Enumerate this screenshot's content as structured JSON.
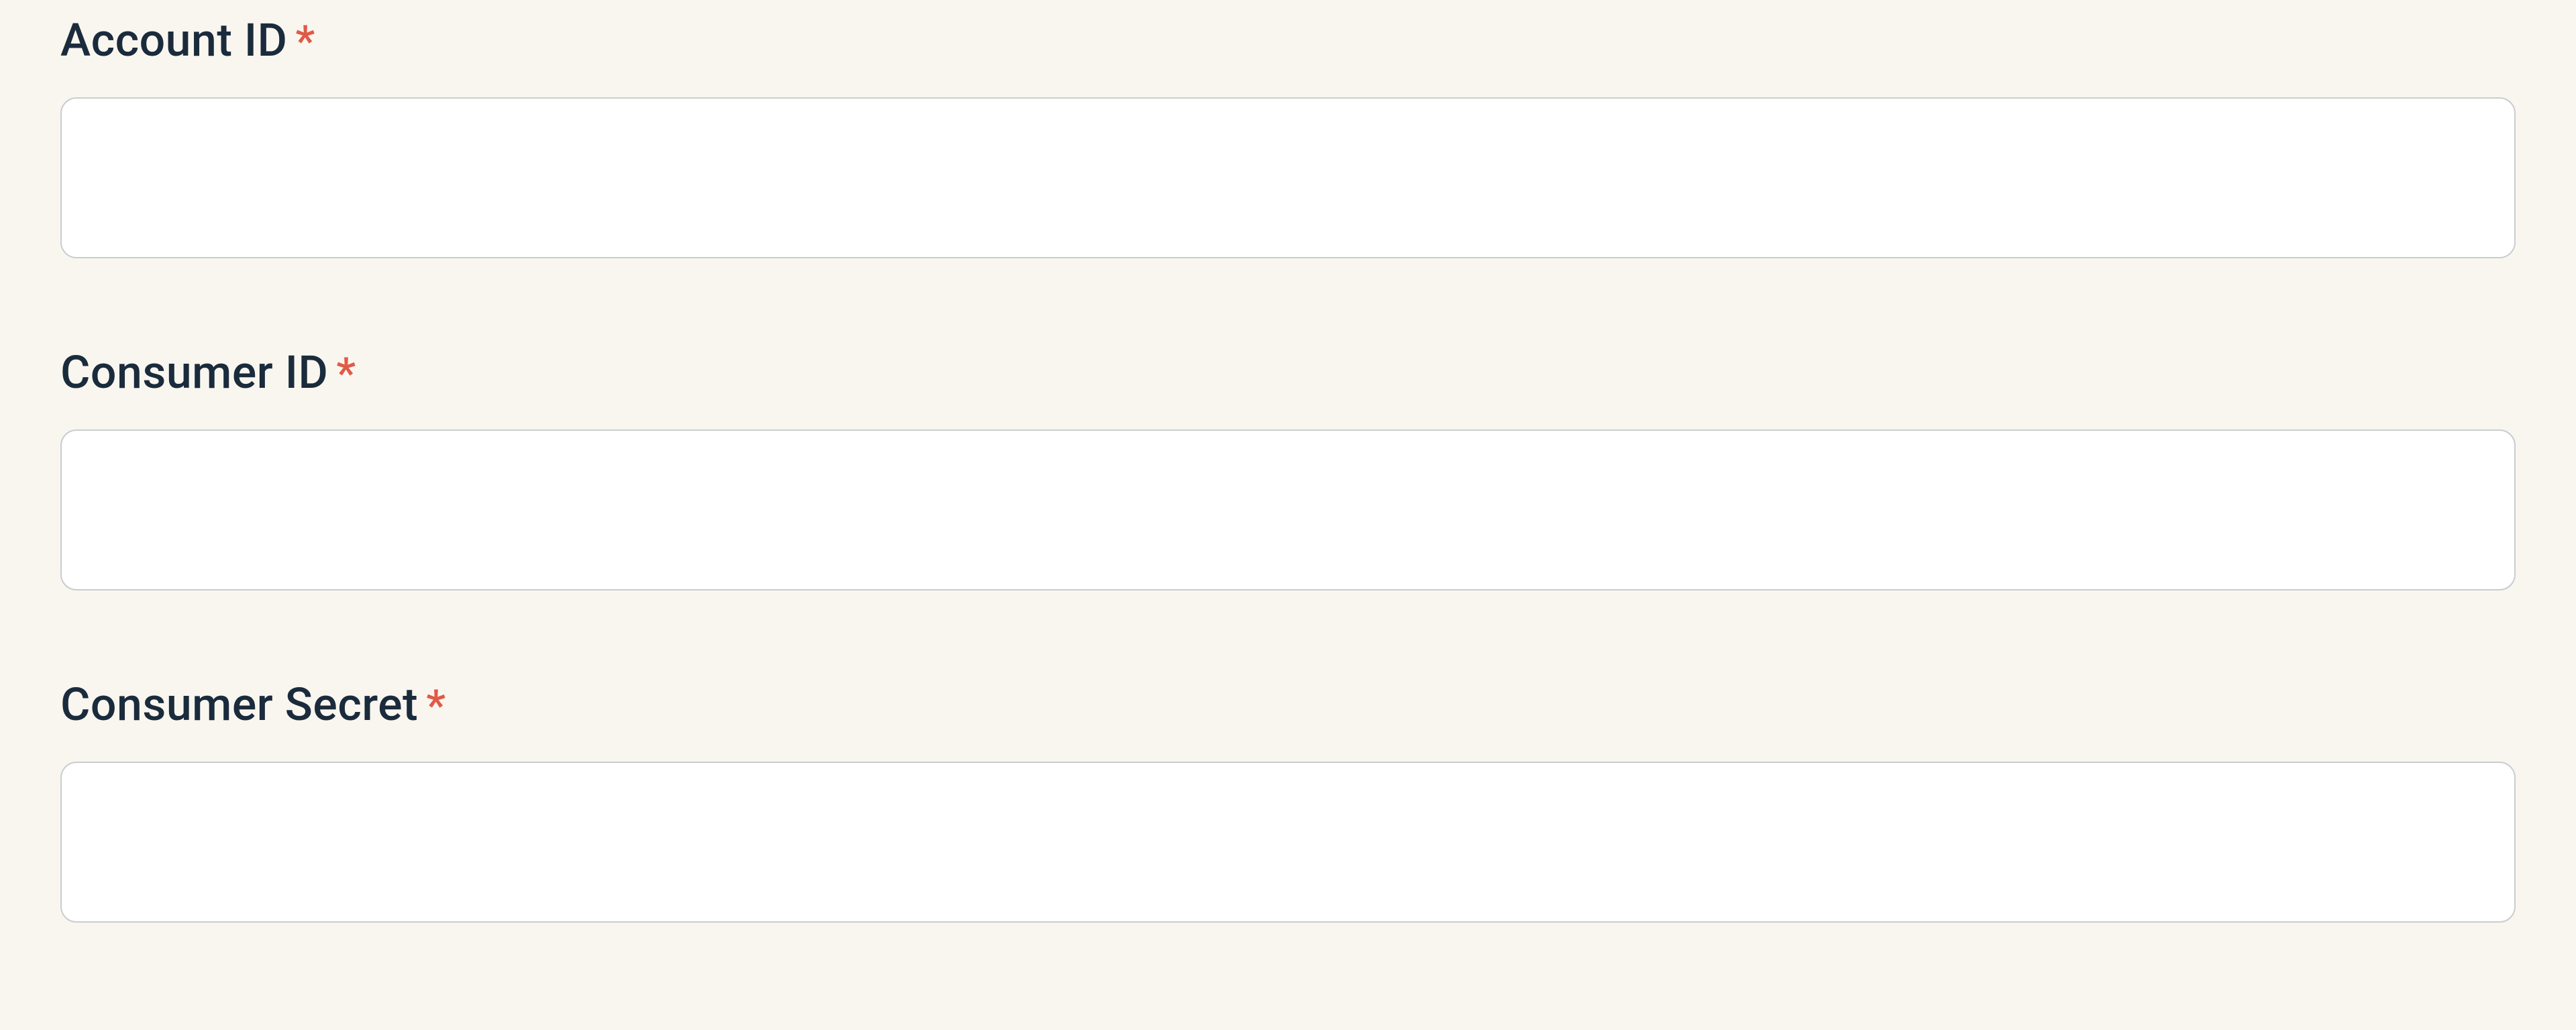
{
  "form": {
    "fields": [
      {
        "label": "Account ID",
        "required_marker": "*",
        "value": "",
        "placeholder": ""
      },
      {
        "label": "Consumer ID",
        "required_marker": "*",
        "value": "",
        "placeholder": ""
      },
      {
        "label": "Consumer Secret",
        "required_marker": "*",
        "value": "",
        "placeholder": ""
      }
    ]
  }
}
